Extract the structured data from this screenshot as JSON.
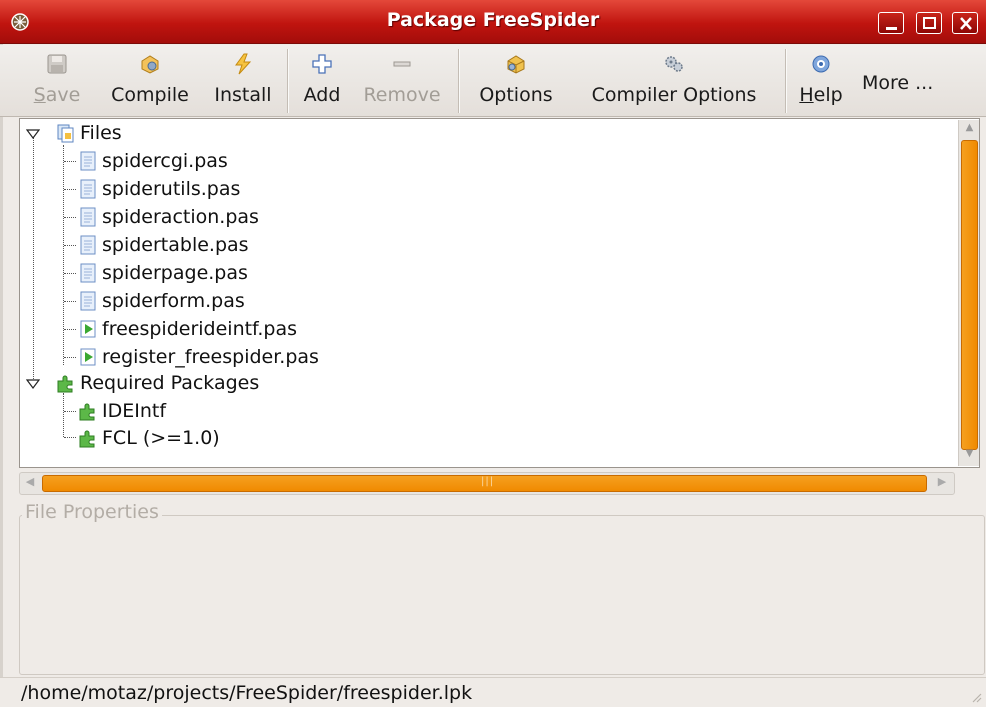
{
  "window": {
    "title": "Package FreeSpider"
  },
  "toolbar": {
    "save": "Save",
    "save_accel": "S",
    "save_rest": "ave",
    "compile": "Compile",
    "install": "Install",
    "add": "Add",
    "remove": "Remove",
    "options": "Options",
    "compiler_options": "Compiler Options",
    "help_accel": "H",
    "help_rest": "elp",
    "more": "More ..."
  },
  "tree": {
    "files_label": "Files",
    "files": [
      {
        "name": "spidercgi.pas",
        "icon": "pascal-unit-icon"
      },
      {
        "name": "spiderutils.pas",
        "icon": "pascal-unit-icon"
      },
      {
        "name": "spideraction.pas",
        "icon": "pascal-unit-icon"
      },
      {
        "name": "spidertable.pas",
        "icon": "pascal-unit-icon"
      },
      {
        "name": "spiderpage.pas",
        "icon": "pascal-unit-icon"
      },
      {
        "name": "spiderform.pas",
        "icon": "pascal-unit-icon"
      },
      {
        "name": "freespiderideintf.pas",
        "icon": "register-unit-icon"
      },
      {
        "name": "register_freespider.pas",
        "icon": "register-unit-icon"
      }
    ],
    "required_label": "Required Packages",
    "required": [
      {
        "name": "IDEIntf"
      },
      {
        "name": "FCL (>=1.0)"
      }
    ]
  },
  "properties": {
    "legend": "File Properties"
  },
  "status": {
    "path": "/home/motaz/projects/FreeSpider/freespider.lpk"
  },
  "colors": {
    "titlebar": "#c0140f",
    "scrollbar_accent": "#f08a00",
    "window_bg": "#efebe7"
  }
}
